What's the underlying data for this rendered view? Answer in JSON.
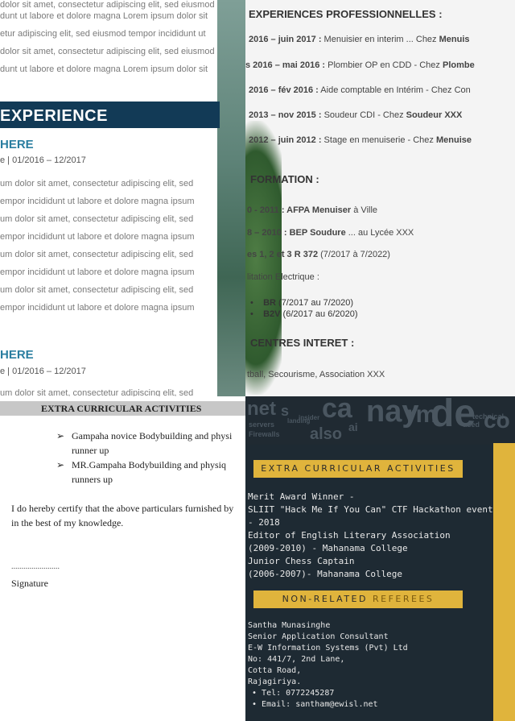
{
  "panel_a": {
    "top_lines": [
      "dolor sit amet, consectetur adipiscing elit, sed eiusmod",
      "dunt ut labore et dolore magna Lorem ipsum dolor sit",
      "etur adipiscing elit, sed eiusmod tempor incididunt ut",
      "dolor sit amet, consectetur adipiscing elit, sed eiusmod",
      "dunt ut labore et dolore magna Lorem ipsum dolor sit"
    ],
    "banner": "EXPERIENCE",
    "job1_title": "HERE",
    "job1_date": "e | 01/2016 – 12/2017",
    "job1_lines": [
      "um dolor sit amet, consectetur adipiscing elit, sed",
      "empor incididunt ut labore et dolore magna ipsum",
      "um dolor sit amet, consectetur adipiscing elit, sed",
      "empor incididunt ut labore et dolore magna ipsum",
      "um dolor sit amet, consectetur adipiscing elit, sed",
      "empor incididunt ut labore et dolore magna ipsum",
      "um dolor sit amet, consectetur adipiscing elit, sed",
      "empor incididunt ut labore et dolore magna ipsum"
    ],
    "job2_title": "HERE",
    "job2_date": "e | 01/2016 – 12/2017",
    "job2_partial": "um dolor sit amet, consectetur adipiscing elit, sed"
  },
  "panel_b": {
    "exp_heading": "EXPERIENCES PROFESSIONNELLES :",
    "exp_lines": [
      {
        "date": "2016 – juin 2017 :",
        "rest": " Menuisier en interim ... Chez ",
        "bold_end": "Menuis"
      },
      {
        "date": "s 2016 – mai 2016 :",
        "rest": " Plombier OP en CDD - Chez ",
        "bold_end": "Plombe"
      },
      {
        "date": "2016 – fév 2016 :",
        "rest": " Aide comptable en Intérim - Chez Con",
        "bold_end": ""
      },
      {
        "date": "2013 – nov 2015 :",
        "rest": " Soudeur CDI - Chez ",
        "bold_end": "Soudeur XXX"
      },
      {
        "date": "2012 – juin 2012 :",
        "rest": " Stage en menuiserie - Chez ",
        "bold_end": "Menuise"
      }
    ],
    "formation_heading": "FORMATION :",
    "formation_lines": [
      {
        "bold": "0 - 2011 : AFPA Menuiser",
        "rest": " à Ville"
      },
      {
        "bold": "8 – 2010 : BEP Soudure",
        "rest": " ... au Lycée XXX"
      },
      {
        "bold": "es 1, 2 et 3 R 372",
        "rest": " (7/2017 à 7/2022)"
      }
    ],
    "habilitation": "litation Electrique :",
    "bullets": [
      {
        "bold": "BR",
        "rest": " (7/2017 au 7/2020)"
      },
      {
        "bold": "B2V",
        "rest": " (6/2017 au 6/2020)"
      }
    ],
    "interests_heading": "CENTRES INTERET :",
    "interests": "tball, Secourisme, Association XXX"
  },
  "panel_c": {
    "section_title": "EXTRA CURRICULAR ACTIVITIES",
    "items": [
      {
        "line1": "Gampaha novice Bodybuilding and physi",
        "line2": "runner up"
      },
      {
        "line1": "MR.Gampaha Bodybuilding and physiq",
        "line2": "runners up"
      }
    ],
    "certify_line1": "I do hereby certify that the above particulars furnished by",
    "certify_line2": "in the best of my knowledge.",
    "dots": "........................",
    "signature": "Signature"
  },
  "panel_d": {
    "cloud_words": [
      "net",
      "s",
      "ca",
      "nay",
      "rm",
      "de",
      "co",
      "servers",
      "Firewalls",
      "also",
      "landing",
      "insider",
      "ai",
      "used",
      "technical"
    ],
    "extra_title": "EXTRA CURRICULAR ACTIVITIES",
    "extra_lines": [
      "Merit Award Winner -",
      "SLIIT \"Hack Me If You Can\" CTF Hackathon event",
      "- 2018",
      "Editor of English Literary Association",
      "(2009-2010) -  Mahanama College",
      "Junior Chess Captain",
      "(2006-2007)- Mahanama College"
    ],
    "referees_title_1": "NON-RELATED ",
    "referees_title_2": "REFEREES",
    "referee_lines": [
      "Santha Munasinghe",
      "Senior Application Consultant",
      "E-W Information Systems (Pvt) Ltd",
      "No: 441/7, 2nd Lane,",
      "Cotta Road,",
      "Rajagiriya."
    ],
    "referee_bullets": [
      "Tel: 0772245287",
      "Email: santham@ewisl.net"
    ],
    "colors": {
      "gold": "#e0b43c",
      "dark": "#1e2a33"
    }
  }
}
